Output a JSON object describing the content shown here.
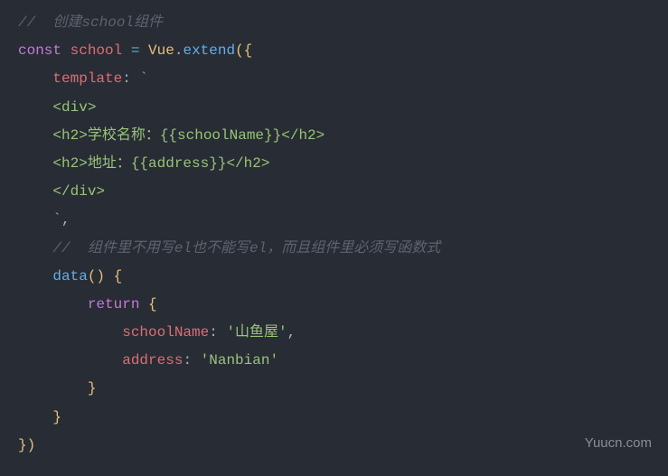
{
  "code": {
    "line1_comment": "//  创建school组件",
    "line2_const": "const",
    "line2_var": "school",
    "line2_eq": " = ",
    "line2_vue": "Vue",
    "line2_dot": ".",
    "line2_extend": "extend",
    "line2_paren": "({",
    "line3_prop": "template",
    "line3_colon": ": ",
    "line3_backtick": "`",
    "line4_div": "<div>",
    "line5_h2open": "<h2>",
    "line5_text": "学校名称：{{schoolName}}",
    "line5_h2close": "</h2>",
    "line6_h2open": "<h2>",
    "line6_text": "地址：{{address}}",
    "line6_h2close": "</h2>",
    "line7_divclose": "</div>",
    "line8_backtick": "`",
    "line8_comma": ",",
    "line9_comment": "//  组件里不用写el也不能写el，而且组件里必须写函数式",
    "line10_data": "data",
    "line10_parens": "() {",
    "line11_return": "return",
    "line11_brace": " {",
    "line12_prop": "schoolName",
    "line12_colon": ": ",
    "line12_val": "'山鱼屋'",
    "line12_comma": ",",
    "line13_prop": "address",
    "line13_colon": ": ",
    "line13_val": "'Nanbian'",
    "line14_brace": "}",
    "line15_brace": "}",
    "line16_close": "})"
  },
  "watermark": "Yuucn.com"
}
